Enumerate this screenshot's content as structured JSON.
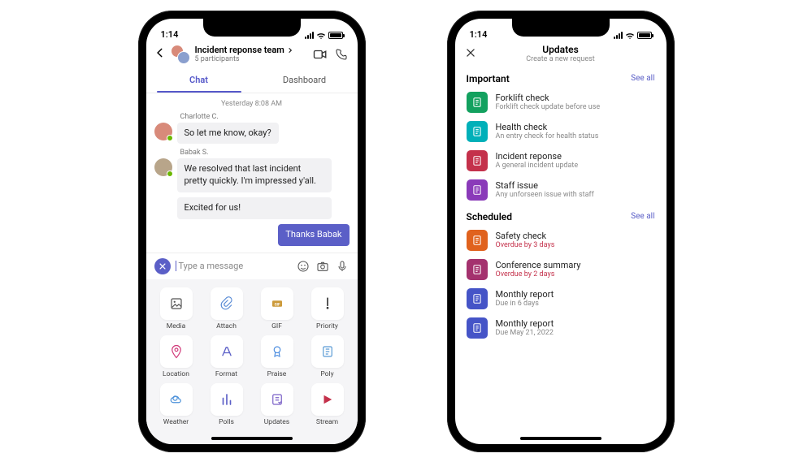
{
  "statusBar": {
    "time": "1:14"
  },
  "leftPhone": {
    "header": {
      "title": "Incident reponse team",
      "subtitle": "5 participants"
    },
    "tabs": [
      "Chat",
      "Dashboard"
    ],
    "timestamp": "Yesterday 8:08 AM",
    "messages": [
      {
        "sender": "Charlotte C.",
        "bubbles": [
          "So let me know, okay?"
        ],
        "mine": false
      },
      {
        "sender": "Babak S.",
        "bubbles": [
          "We resolved that last incident pretty quickly. I'm impressed y'all.",
          "Excited for us!"
        ],
        "mine": false
      },
      {
        "sender": "",
        "bubbles": [
          "Thanks Babak"
        ],
        "mine": true
      }
    ],
    "compose": {
      "placeholder": "Type a message"
    },
    "apps": [
      {
        "label": "Media",
        "icon": "media",
        "color": "#555"
      },
      {
        "label": "Attach",
        "icon": "attach",
        "color": "#5b8dd6"
      },
      {
        "label": "GIF",
        "icon": "gif",
        "color": "#cc9a3a"
      },
      {
        "label": "Priority",
        "icon": "priority",
        "color": "#333"
      },
      {
        "label": "Location",
        "icon": "location",
        "color": "#d13a7a"
      },
      {
        "label": "Format",
        "icon": "format",
        "color": "#5b5fc7"
      },
      {
        "label": "Praise",
        "icon": "praise",
        "color": "#4f8fe0"
      },
      {
        "label": "Poly",
        "icon": "poly",
        "color": "#5b9bd5"
      },
      {
        "label": "Weather",
        "icon": "weather",
        "color": "#4a90d9"
      },
      {
        "label": "Polls",
        "icon": "polls",
        "color": "#5b5fc7"
      },
      {
        "label": "Updates",
        "icon": "updates",
        "color": "#7b61c7"
      },
      {
        "label": "Stream",
        "icon": "stream",
        "color": "#c4314b"
      }
    ]
  },
  "rightPhone": {
    "header": {
      "title": "Updates",
      "subtitle": "Create a new request"
    },
    "sections": [
      {
        "title": "Important",
        "seeAll": "See all",
        "items": [
          {
            "title": "Forklift check",
            "sub": "Forklift check update before use",
            "color": "#13a15f",
            "overdue": false
          },
          {
            "title": "Health check",
            "sub": "An entry check for health status",
            "color": "#00b0b9",
            "overdue": false
          },
          {
            "title": "Incident reponse",
            "sub": "A general incident update",
            "color": "#c4314b",
            "overdue": false
          },
          {
            "title": "Staff issue",
            "sub": "Any unforseen issue with staff",
            "color": "#8a3ab9",
            "overdue": false
          }
        ]
      },
      {
        "title": "Scheduled",
        "seeAll": "See all",
        "items": [
          {
            "title": "Safety check",
            "sub": "Overdue by 3 days",
            "color": "#e0621e",
            "overdue": true
          },
          {
            "title": "Conference summary",
            "sub": "Overdue by 2 days",
            "color": "#a4326e",
            "overdue": true
          },
          {
            "title": "Monthly report",
            "sub": "Due in 6 days",
            "color": "#4554c7",
            "overdue": false
          },
          {
            "title": "Monthly report",
            "sub": "Due May 21, 2022",
            "color": "#4554c7",
            "overdue": false
          }
        ]
      }
    ]
  }
}
